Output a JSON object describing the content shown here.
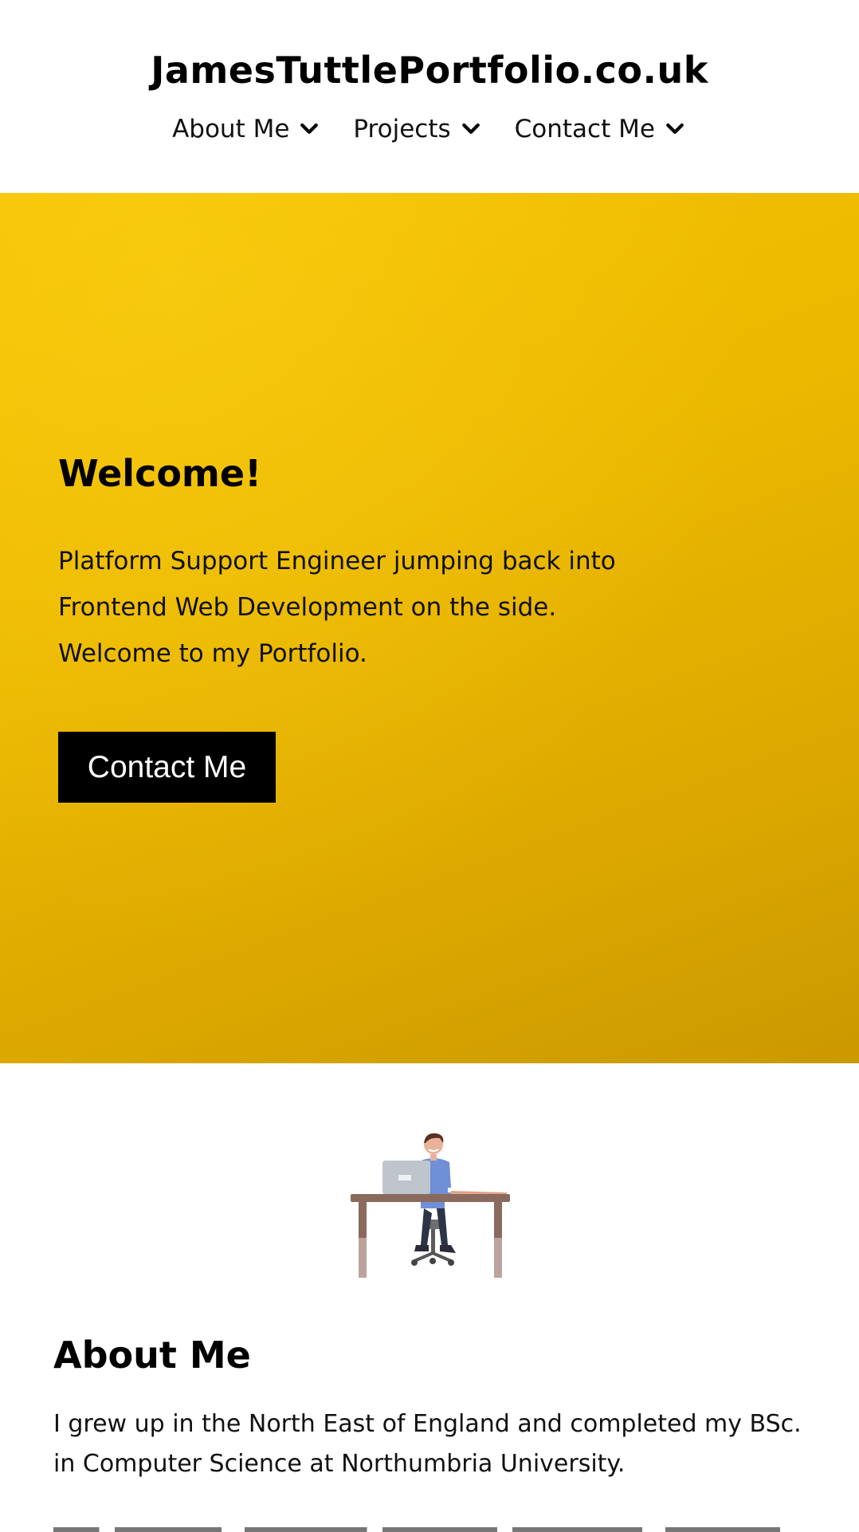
{
  "header": {
    "site_title": "JamesTuttlePortfolio.co.uk",
    "nav": [
      {
        "label": "About Me"
      },
      {
        "label": "Projects"
      },
      {
        "label": "Contact Me"
      }
    ]
  },
  "hero": {
    "title": "Welcome!",
    "lines": [
      "Platform Support Engineer jumping back into",
      "Frontend Web Development on the side.",
      "Welcome to my Portfolio."
    ],
    "button_label": "Contact Me",
    "background_color": "#ecb800"
  },
  "about": {
    "title": "About Me",
    "lines": [
      "I grew up in the North East of England and completed my BSc.",
      "in Computer Science at Northumbria University."
    ],
    "illustration": "person-at-desk-illustration"
  },
  "icons": {
    "nav_chevron": "chevron-down-icon"
  }
}
